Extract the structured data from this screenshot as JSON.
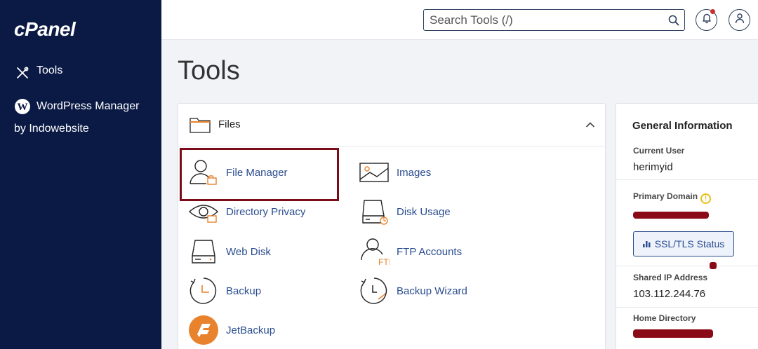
{
  "sidebar": {
    "logo": "cPanel",
    "items": [
      {
        "label": "Tools",
        "icon": "tools-icon"
      },
      {
        "label": "WordPress Manager",
        "label2": "by Indowebsite",
        "icon": "wordpress-icon"
      }
    ]
  },
  "header": {
    "search_placeholder": "Search Tools (/)",
    "icons": [
      "search-icon",
      "bell-icon",
      "user-icon"
    ]
  },
  "page": {
    "title": "Tools"
  },
  "files": {
    "title": "Files",
    "tools": [
      {
        "label": "File Manager",
        "icon": "file-manager-icon"
      },
      {
        "label": "Images",
        "icon": "images-icon"
      },
      {
        "label": "Directory Privacy",
        "icon": "directory-privacy-icon"
      },
      {
        "label": "Disk Usage",
        "icon": "disk-usage-icon"
      },
      {
        "label": "Web Disk",
        "icon": "web-disk-icon"
      },
      {
        "label": "FTP Accounts",
        "icon": "ftp-accounts-icon"
      },
      {
        "label": "Backup",
        "icon": "backup-icon"
      },
      {
        "label": "Backup Wizard",
        "icon": "backup-wizard-icon"
      },
      {
        "label": "JetBackup",
        "icon": "jetbackup-icon"
      }
    ]
  },
  "info": {
    "title": "General Information",
    "current_user_label": "Current User",
    "current_user": "herimyid",
    "primary_domain_label": "Primary Domain",
    "ssl_button": "SSL/TLS Status",
    "shared_ip_label": "Shared IP Address",
    "shared_ip": "103.112.244.76",
    "home_dir_label": "Home Directory"
  },
  "colors": {
    "sidebar_bg": "#0b1a45",
    "link": "#2a4d8f",
    "accent_orange": "#e8822c",
    "highlight_border": "#7a0b18",
    "warn": "#e6b800"
  }
}
